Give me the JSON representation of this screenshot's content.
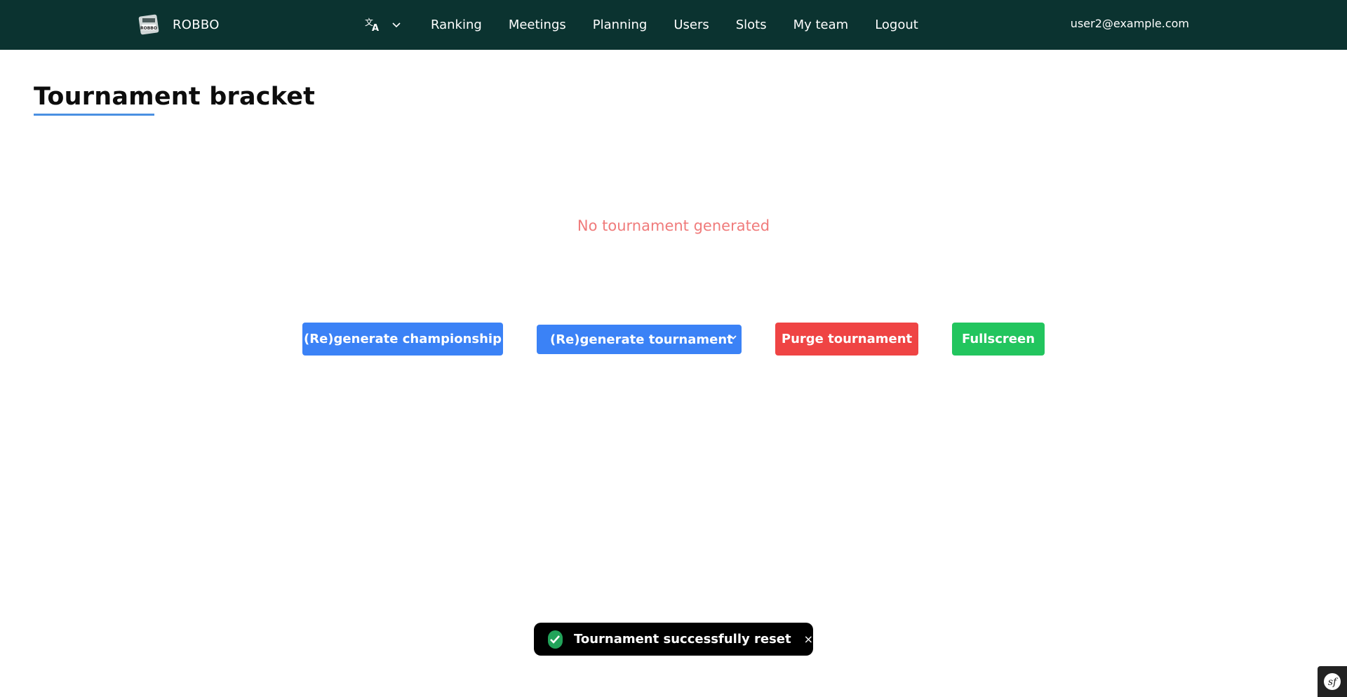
{
  "brand": {
    "name": "ROBBO",
    "logo_icon": "robbo-logo-icon"
  },
  "nav": {
    "language_icon": "translate-icon",
    "links": [
      "Ranking",
      "Meetings",
      "Planning",
      "Users",
      "Slots",
      "My team",
      "Logout"
    ],
    "user_email": "user2@example.com"
  },
  "page": {
    "title": "Tournament bracket",
    "empty_message": "No tournament generated"
  },
  "actions": {
    "regenerate_championship": "(Re)generate championship",
    "regenerate_tournament": "(Re)generate tournament",
    "purge_tournament": "Purge tournament",
    "fullscreen": "Fullscreen"
  },
  "toast": {
    "message": "Tournament successfully reset",
    "close": "×",
    "icon": "check-icon"
  },
  "colors": {
    "navbar": "#0b3330",
    "primary": "#3b82f6",
    "danger": "#ef4444",
    "success": "#22c55e",
    "empty_text": "#f07b7b",
    "title_accent": "#4a90e2"
  }
}
